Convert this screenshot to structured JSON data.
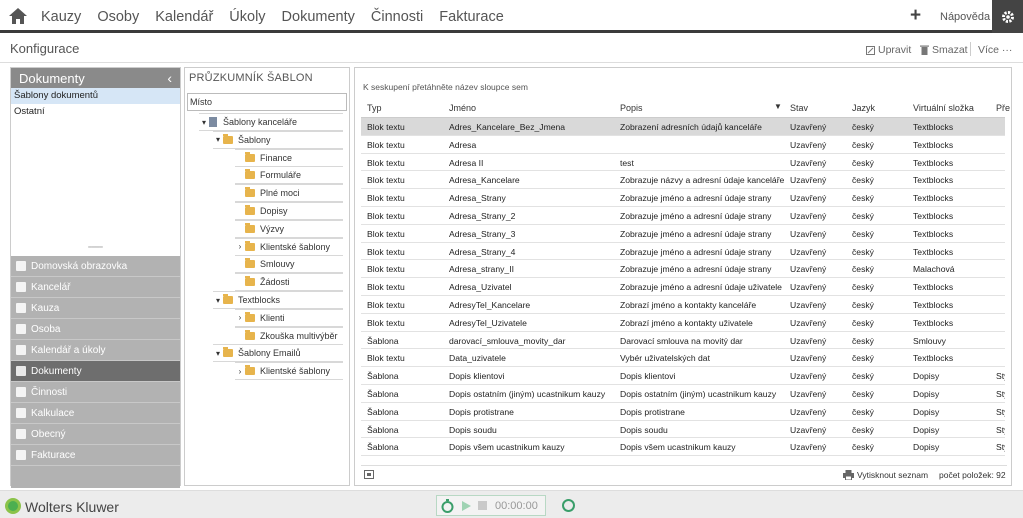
{
  "nav": {
    "items": [
      "Kauzy",
      "Osoby",
      "Kalendář",
      "Úkoly",
      "Dokumenty",
      "Činnosti",
      "Fakturace"
    ],
    "help": "Nápověda"
  },
  "page": {
    "title": "Konfigurace",
    "actions": {
      "edit": "Upravit",
      "delete": "Smazat",
      "more": "Více ···"
    }
  },
  "left": {
    "header": "Dokumenty",
    "items": [
      "Šablony dokumentů",
      "Ostatní"
    ],
    "nav": [
      "Domovská obrazovka",
      "Kancelář",
      "Kauza",
      "Osoba",
      "Kalendář a úkoly",
      "Dokumenty",
      "Činnosti",
      "Kalkulace",
      "Obecný",
      "Fakturace"
    ],
    "active_nav": "Dokumenty"
  },
  "tree": {
    "title": "PRŮZKUMNÍK ŠABLON",
    "column": "Místo",
    "nodes": [
      {
        "label": "Šablony kanceláře",
        "level": 0,
        "icon": "file",
        "expander": "collapse"
      },
      {
        "label": "Šablony",
        "level": 1,
        "icon": "folder",
        "expander": "collapse"
      },
      {
        "label": "Finance",
        "level": 2,
        "icon": "folder",
        "expander": ""
      },
      {
        "label": "Formuláře",
        "level": 2,
        "icon": "folder",
        "expander": ""
      },
      {
        "label": "Plné moci",
        "level": 2,
        "icon": "folder",
        "expander": ""
      },
      {
        "label": "Dopisy",
        "level": 2,
        "icon": "folder",
        "expander": ""
      },
      {
        "label": "Výzvy",
        "level": 2,
        "icon": "folder",
        "expander": ""
      },
      {
        "label": "Klientské šablony",
        "level": 2,
        "icon": "folder",
        "expander": "expand"
      },
      {
        "label": "Smlouvy",
        "level": 2,
        "icon": "folder",
        "expander": ""
      },
      {
        "label": "Žádosti",
        "level": 2,
        "icon": "folder",
        "expander": ""
      },
      {
        "label": "Textblocks",
        "level": 1,
        "icon": "folder",
        "expander": "collapse"
      },
      {
        "label": "Klienti",
        "level": 2,
        "icon": "folder",
        "expander": "expand"
      },
      {
        "label": "Zkouška multivýběr",
        "level": 2,
        "icon": "folder",
        "expander": ""
      },
      {
        "label": "Šablony Emailů",
        "level": 1,
        "icon": "folder",
        "expander": "collapse"
      },
      {
        "label": "Klientské šablony",
        "level": 2,
        "icon": "folder",
        "expander": "expand"
      }
    ]
  },
  "grid": {
    "group_hint": "K seskupení přetáhněte název sloupce sem",
    "columns": [
      "Typ",
      "Jméno",
      "Popis",
      "Stav",
      "Jazyk",
      "Virtuální složka",
      "Pře"
    ],
    "rows": [
      [
        "Blok textu",
        "Adres_Kancelare_Bez_Jmena",
        "Zobrazení adresních údajů kanceláře",
        "Uzavřený",
        "český",
        "Textblocks",
        ""
      ],
      [
        "Blok textu",
        "Adresa",
        "",
        "Uzavřený",
        "český",
        "Textblocks",
        ""
      ],
      [
        "Blok textu",
        "Adresa II",
        "test",
        "Uzavřený",
        "český",
        "Textblocks",
        ""
      ],
      [
        "Blok textu",
        "Adresa_Kancelare",
        "Zobrazuje názvy a adresní údaje kanceláře",
        "Uzavřený",
        "český",
        "Textblocks",
        ""
      ],
      [
        "Blok textu",
        "Adresa_Strany",
        "Zobrazuje jméno a adresní údaje strany",
        "Uzavřený",
        "český",
        "Textblocks",
        ""
      ],
      [
        "Blok textu",
        "Adresa_Strany_2",
        "Zobrazuje jméno a adresní údaje strany",
        "Uzavřený",
        "český",
        "Textblocks",
        ""
      ],
      [
        "Blok textu",
        "Adresa_Strany_3",
        "Zobrazuje jméno a adresní údaje strany",
        "Uzavřený",
        "český",
        "Textblocks",
        ""
      ],
      [
        "Blok textu",
        "Adresa_Strany_4",
        "Zobrazuje jméno a adresní údaje strany",
        "Uzavřený",
        "český",
        "Textblocks",
        ""
      ],
      [
        "Blok textu",
        "Adresa_strany_II",
        "Zobrazuje jméno a adresní údaje strany",
        "Uzavřený",
        "český",
        "Malachová",
        ""
      ],
      [
        "Blok textu",
        "Adresa_Uzivatel",
        "Zobrazuje jméno a adresní údaje uživatele",
        "Uzavřený",
        "český",
        "Textblocks",
        ""
      ],
      [
        "Blok textu",
        "AdresyTel_Kancelare",
        "Zobrazí jméno a kontakty kanceláře",
        "Uzavřený",
        "český",
        "Textblocks",
        ""
      ],
      [
        "Blok textu",
        "AdresyTel_Uzivatele",
        "Zobrazí jméno a kontakty uživatele",
        "Uzavřený",
        "český",
        "Textblocks",
        ""
      ],
      [
        "Šablona",
        "darovací_smlouva_movity_dar",
        "Darovací smlouva na movitý dar",
        "Uzavřený",
        "český",
        "Smlouvy",
        ""
      ],
      [
        "Blok textu",
        "Data_uzivatele",
        "Vybér uživatelských dat",
        "Uzavřený",
        "český",
        "Textblocks",
        ""
      ],
      [
        "Šablona",
        "Dopis klientovi",
        "Dopis klientovi",
        "Uzavřený",
        "český",
        "Dopisy",
        "Sty"
      ],
      [
        "Šablona",
        "Dopis ostatním (jiným) ucastnikum kauzy",
        "Dopis ostatním (jiným) ucastnikum kauzy",
        "Uzavřený",
        "český",
        "Dopisy",
        "Sty"
      ],
      [
        "Šablona",
        "Dopis protistrane",
        "Dopis protistrane",
        "Uzavřený",
        "český",
        "Dopisy",
        "Sty"
      ],
      [
        "Šablona",
        "Dopis soudu",
        "Dopis soudu",
        "Uzavřený",
        "český",
        "Dopisy",
        "Sty"
      ],
      [
        "Šablona",
        "Dopis všem ucastnikum kauzy",
        "Dopis všem ucastnikum kauzy",
        "Uzavřený",
        "český",
        "Dopisy",
        "Sty"
      ]
    ],
    "footer": {
      "print": "Vytisknout seznam",
      "count": "počet položek: 92"
    }
  },
  "bottom": {
    "brand": "Wolters Kluwer",
    "timer": "00:00:00"
  },
  "colors": {
    "accent": "#3b3b3b",
    "selected": "#d6e6f6",
    "folder": "#e7b44c",
    "brand_green": "#4caf50"
  }
}
